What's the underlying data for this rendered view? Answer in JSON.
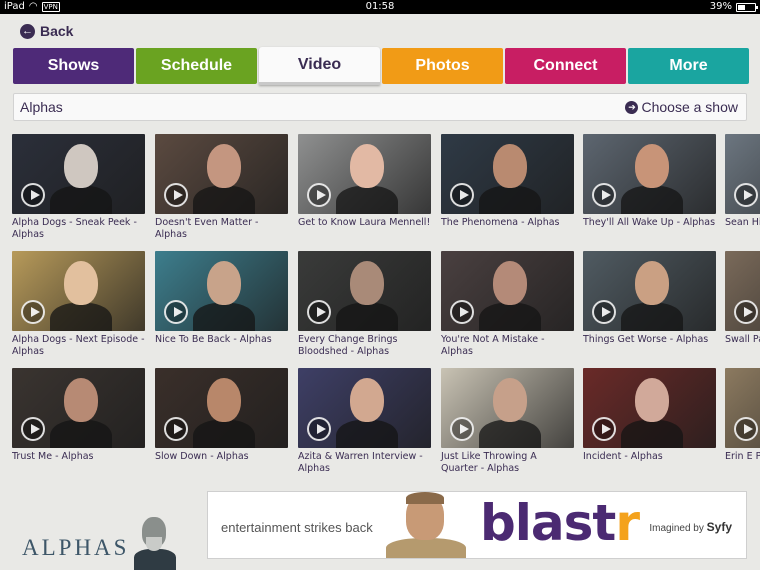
{
  "status_bar": {
    "device": "iPad",
    "vpn": "VPN",
    "time": "01:58",
    "battery": "39%",
    "battery_level": 0.39
  },
  "back": {
    "label": "Back"
  },
  "tabs": [
    {
      "label": "Shows",
      "color": "#4e2a78"
    },
    {
      "label": "Schedule",
      "color": "#6aa321"
    },
    {
      "label": "Video",
      "color": "#fafafa",
      "active": true
    },
    {
      "label": "Photos",
      "color": "#f19b16"
    },
    {
      "label": "Connect",
      "color": "#c81e63"
    },
    {
      "label": "More",
      "color": "#1aa5a0"
    }
  ],
  "title_bar": {
    "title": "Alphas",
    "choose_show": "Choose a show"
  },
  "videos": [
    {
      "title": "Alpha Dogs - Sneak Peek - Alphas",
      "tint": "#2b2f3a",
      "face": "#cfc7c0"
    },
    {
      "title": "Doesn't Even Matter - Alphas",
      "tint": "#5b4a40",
      "face": "#c49680"
    },
    {
      "title": "Get to Know Laura Mennell!",
      "tint": "#8f9090",
      "face": "#e2b9a4"
    },
    {
      "title": "The Phenomena - Alphas",
      "tint": "#2f3a46",
      "face": "#b98a70"
    },
    {
      "title": "They'll All Wake Up - Alphas",
      "tint": "#5d6670",
      "face": "#c89478"
    },
    {
      "title": "Sean Highl",
      "tint": "#6c7680",
      "face": "#b58b73"
    },
    {
      "title": "Alpha Dogs - Next Episode - Alphas",
      "tint": "#b79a5a",
      "face": "#e2c09e"
    },
    {
      "title": "Nice To Be Back - Alphas",
      "tint": "#3d7e8d",
      "face": "#c8a38a"
    },
    {
      "title": "Every Change Brings Bloodshed - Alphas",
      "tint": "#3a3b3a",
      "face": "#a98a78"
    },
    {
      "title": "You're Not A Mistake - Alphas",
      "tint": "#4a4040",
      "face": "#b48a78"
    },
    {
      "title": "Things Get Worse - Alphas",
      "tint": "#505b62",
      "face": "#caa083"
    },
    {
      "title": "Swall Panel",
      "tint": "#7a6a5a",
      "face": "#c09a80"
    },
    {
      "title": "Trust Me - Alphas",
      "tint": "#3a3430",
      "face": "#b78a74"
    },
    {
      "title": "Slow Down - Alphas",
      "tint": "#3a2f2a",
      "face": "#b8876a"
    },
    {
      "title": "Azita & Warren Interview - Alphas",
      "tint": "#3e3f66",
      "face": "#d2a890"
    },
    {
      "title": "Just Like Throwing A Quarter - Alphas",
      "tint": "#c9c3b4",
      "face": "#c6a08a"
    },
    {
      "title": "Incident - Alphas",
      "tint": "#6a2a28",
      "face": "#d1a99a"
    },
    {
      "title": "Erin E Panel",
      "tint": "#8c7a60",
      "face": "#d4b090"
    }
  ],
  "brand": {
    "logo": "ALPHAS"
  },
  "ad": {
    "tagline": "entertainment strikes back",
    "brand_left": "blast",
    "brand_right": "r",
    "imagined": "Imagined by",
    "network": "Syfy"
  }
}
